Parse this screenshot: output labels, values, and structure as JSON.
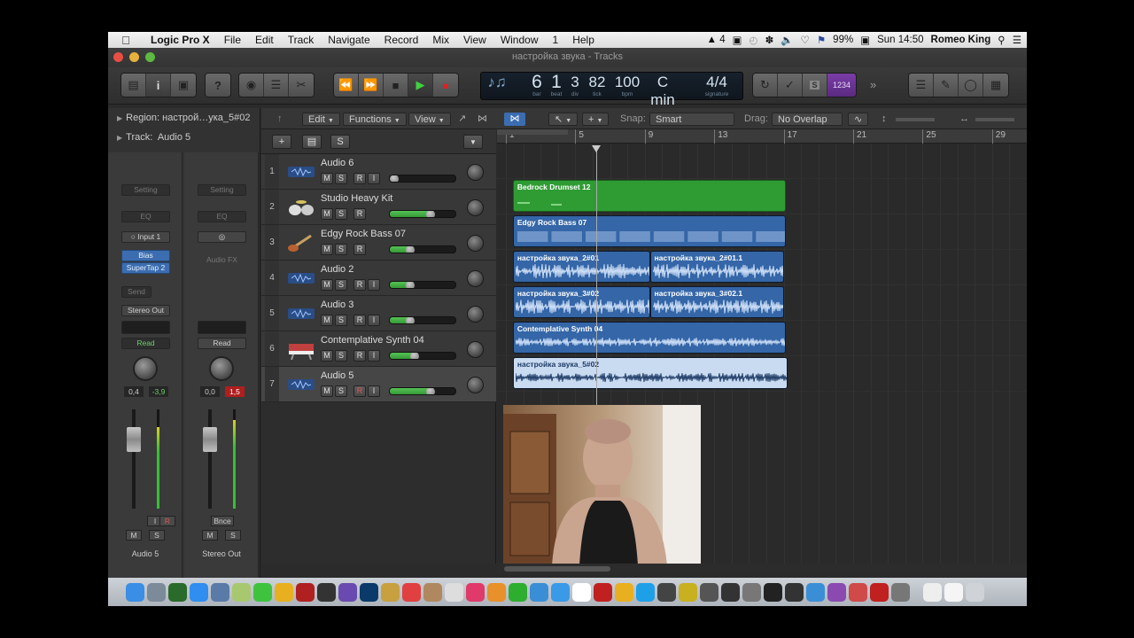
{
  "menubar": {
    "app": "Logic Pro X",
    "items": [
      "File",
      "Edit",
      "Track",
      "Navigate",
      "Record",
      "Mix",
      "View",
      "Window",
      "1",
      "Help"
    ],
    "status": {
      "adobe": "4",
      "battery": "99%",
      "clock": "Sun 14:50",
      "user": "Romeo King"
    }
  },
  "window": {
    "title": "настройка звука - Tracks"
  },
  "lcd": {
    "bar": "6",
    "bar_label": "bar",
    "beat": "1",
    "beat_label": "beat",
    "div": "3",
    "div_label": "div",
    "tick": "82",
    "tick_label": "tick",
    "bpm": "100",
    "bpm_label": "bpm",
    "key": "C min",
    "key_label": "key",
    "signature": "4/4",
    "signature_label": "signature",
    "count_in": "1234"
  },
  "inspector": {
    "region_label": "Region:",
    "region_value": "настрой…ука_5#02",
    "track_label": "Track:",
    "track_value": "Audio 5",
    "strip1": {
      "setting": "Setting",
      "eq": "EQ",
      "input": "Input 1",
      "plugin1": "Bias",
      "plugin2": "SuperTap 2",
      "send": "Send",
      "output": "Stereo Out",
      "automation": "Read",
      "val1": "0,4",
      "val2": "-3,9",
      "btn_i": "I",
      "btn_r": "R",
      "btn_m": "M",
      "btn_s": "S",
      "name": "Audio 5"
    },
    "strip2": {
      "setting": "Setting",
      "eq": "EQ",
      "fx": "Audio FX",
      "automation": "Read",
      "val1": "0,0",
      "val2": "1,5",
      "bnce": "Bnce",
      "btn_m": "M",
      "btn_s": "S",
      "name": "Stereo Out"
    }
  },
  "arrange_toolbar": {
    "edit": "Edit",
    "functions": "Functions",
    "view": "View",
    "snap_label": "Snap:",
    "snap_value": "Smart",
    "drag_label": "Drag:",
    "drag_value": "No Overlap"
  },
  "tracklist_head": {
    "s_label": "S"
  },
  "ruler": [
    "1",
    "5",
    "9",
    "13",
    "17",
    "21",
    "25",
    "29"
  ],
  "tracks": [
    {
      "num": "1",
      "name": "Audio 6",
      "m": "M",
      "s": "S",
      "r": "R",
      "i": "I",
      "volume": 0.0,
      "icon": "waveform-icon"
    },
    {
      "num": "2",
      "name": "Studio Heavy Kit",
      "m": "M",
      "s": "S",
      "r": "R",
      "i": "",
      "volume": 0.7,
      "icon": "drumkit-icon"
    },
    {
      "num": "3",
      "name": "Edgy Rock Bass 07",
      "m": "M",
      "s": "S",
      "r": "R",
      "i": "",
      "volume": 0.35,
      "icon": "bass-guitar-icon"
    },
    {
      "num": "4",
      "name": "Audio 2",
      "m": "M",
      "s": "S",
      "r": "R",
      "i": "I",
      "volume": 0.35,
      "icon": "waveform-icon"
    },
    {
      "num": "5",
      "name": "Audio 3",
      "m": "M",
      "s": "S",
      "r": "R",
      "i": "I",
      "volume": 0.35,
      "icon": "waveform-icon"
    },
    {
      "num": "6",
      "name": "Contemplative Synth 04",
      "m": "M",
      "s": "S",
      "r": "R",
      "i": "I",
      "volume": 0.42,
      "icon": "keyboard-icon"
    },
    {
      "num": "7",
      "name": "Audio 5",
      "m": "M",
      "s": "S",
      "r": "R",
      "i": "I",
      "volume": 0.7,
      "icon": "waveform-icon"
    }
  ],
  "regions": [
    {
      "lane": 1,
      "name": "Bedrock Drumset 12",
      "start_bar": 1.4,
      "end_bar": 17.1,
      "color": "green"
    },
    {
      "lane": 2,
      "name": "Edgy Rock Bass 07",
      "start_bar": 1.4,
      "end_bar": 17.1,
      "color": "blue"
    },
    {
      "lane": 3,
      "name": "настройка звука_2#01",
      "start_bar": 1.4,
      "end_bar": 9.3,
      "color": "blue"
    },
    {
      "lane": 3,
      "name": "настройка звука_2#01.1",
      "start_bar": 9.3,
      "end_bar": 17.0,
      "color": "blue"
    },
    {
      "lane": 4,
      "name": "настройка звука_3#02",
      "start_bar": 1.4,
      "end_bar": 9.3,
      "color": "blue"
    },
    {
      "lane": 4,
      "name": "настройка звука_3#02.1",
      "start_bar": 9.3,
      "end_bar": 17.0,
      "color": "blue"
    },
    {
      "lane": 5,
      "name": "Contemplative Synth 04",
      "start_bar": 1.4,
      "end_bar": 17.1,
      "color": "blue"
    },
    {
      "lane": 6,
      "name": "настройка звука_5#02",
      "start_bar": 1.4,
      "end_bar": 17.2,
      "color": "selected"
    }
  ],
  "playhead_bar": 6.2
}
